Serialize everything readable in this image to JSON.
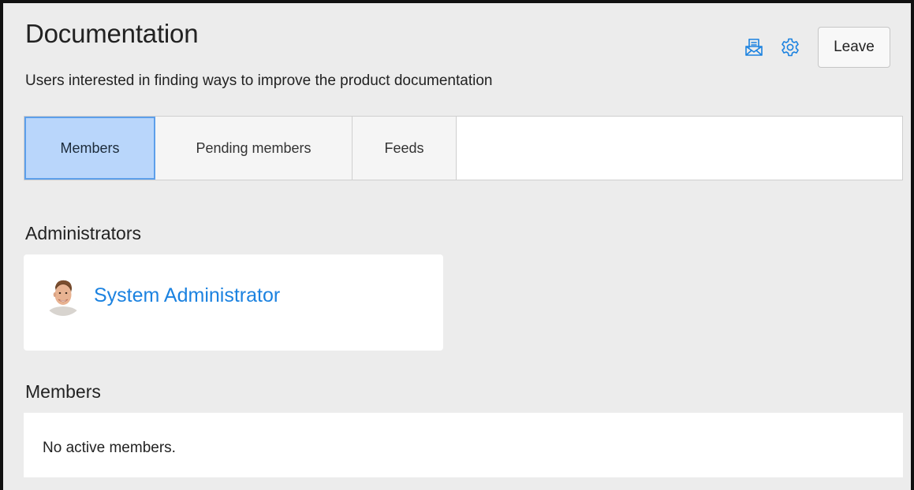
{
  "group": {
    "title": "Documentation",
    "description": "Users interested in finding ways to improve the product documentation"
  },
  "actions": {
    "mail_icon": "mail-icon",
    "gear_icon": "gear-icon",
    "leave_label": "Leave"
  },
  "tabs": [
    {
      "label": "Members",
      "active": true
    },
    {
      "label": "Pending members",
      "active": false
    },
    {
      "label": "Feeds",
      "active": false
    }
  ],
  "administrators": {
    "heading": "Administrators",
    "items": [
      {
        "name": "System Administrator",
        "avatar": "user-avatar"
      }
    ]
  },
  "members": {
    "heading": "Members",
    "empty_message": "No active members."
  },
  "colors": {
    "accent": "#1b82e0",
    "active_tab_bg": "#b9d6fb",
    "active_tab_border": "#5d9fea",
    "page_bg": "#ececec"
  }
}
